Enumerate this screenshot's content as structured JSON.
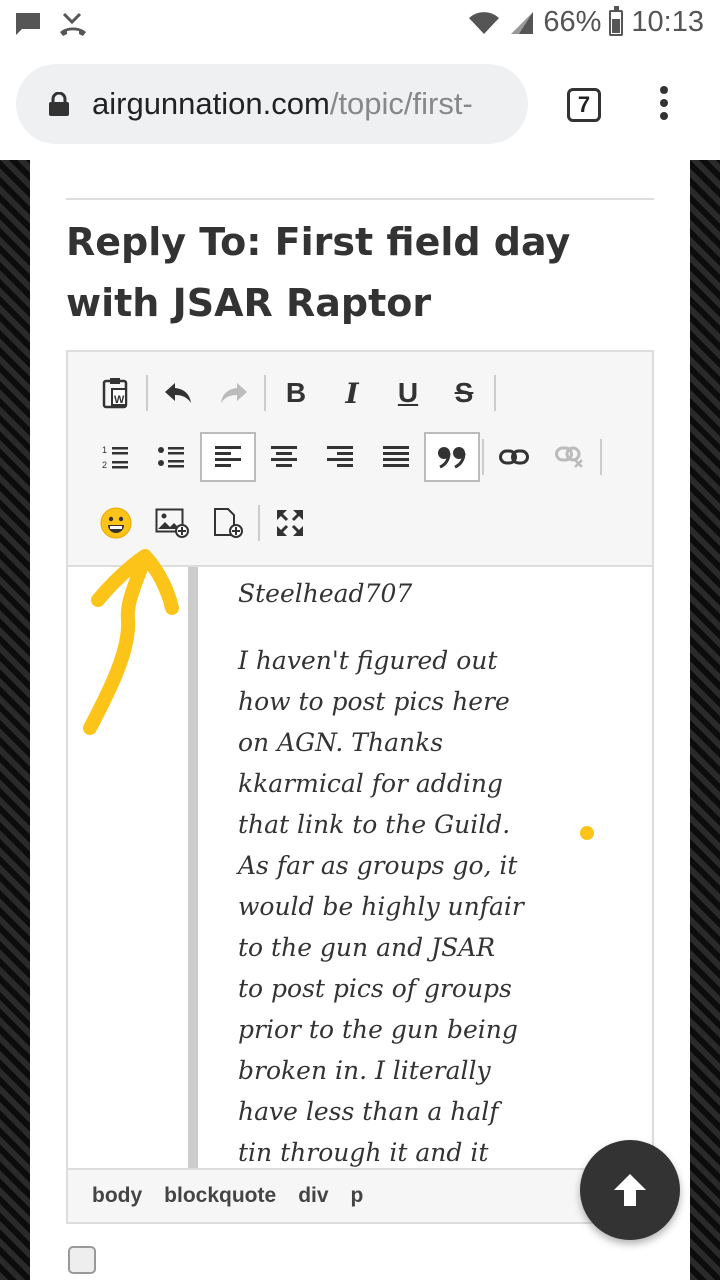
{
  "status_bar": {
    "battery": "66%",
    "time": "10:13"
  },
  "browser": {
    "url_domain": "airgunnation.com",
    "url_path": "/topic/first-",
    "tab_count": "7"
  },
  "page": {
    "title": "Reply To: First field day with JSAR Raptor"
  },
  "toolbar": {
    "bold": "B",
    "italic": "I",
    "underline": "U",
    "strikethrough": "S"
  },
  "editor": {
    "quote_author": "Steelhead707",
    "quote_body": "I haven't figured out how to post pics here on AGN. Thanks kkarmical for adding that link to the Guild. As far as groups go, it would be highly unfair to the gun and JSAR to post pics of groups prior to the gun being broken in. I literally have less than a half tin through it and it",
    "path": [
      "body",
      "blockquote",
      "div",
      "p"
    ]
  },
  "colors": {
    "annotation": "#fcc419",
    "scroll_button": "#333333"
  }
}
